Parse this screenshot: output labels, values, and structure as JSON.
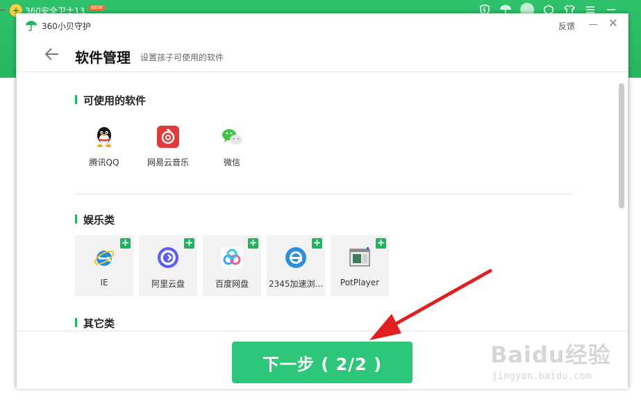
{
  "background_app": {
    "title": "360安全卫士13",
    "badge": "NEW"
  },
  "dialog": {
    "app_title": "360小贝守护",
    "feedback_label": "反馈",
    "page_title": "软件管理",
    "page_subtitle": "设置孩子可使用的软件",
    "sections": {
      "allowed_title": "可使用的软件",
      "entertainment_title": "娱乐类",
      "other_title": "其它类"
    },
    "allowed_apps": [
      {
        "label": "腾讯QQ",
        "icon": "qq-icon"
      },
      {
        "label": "网易云音乐",
        "icon": "netease-music-icon"
      },
      {
        "label": "微信",
        "icon": "wechat-icon"
      }
    ],
    "entertainment_apps": [
      {
        "label": "IE",
        "icon": "ie-icon"
      },
      {
        "label": "阿里云盘",
        "icon": "aliyun-drive-icon"
      },
      {
        "label": "百度网盘",
        "icon": "baidu-netdisk-icon"
      },
      {
        "label": "2345加速浏...",
        "icon": "browser-2345-icon"
      },
      {
        "label": "PotPlayer",
        "icon": "potplayer-icon"
      }
    ],
    "add_symbol": "+",
    "next_button_label": "下一步 ( 2/2 )"
  },
  "watermark": {
    "brand": "Baidu经验",
    "domain": "jingyan.baidu.com"
  },
  "colors": {
    "brand_green": "#2ec779",
    "accent_green": "#22b35e",
    "arrow_red": "#e02020"
  }
}
